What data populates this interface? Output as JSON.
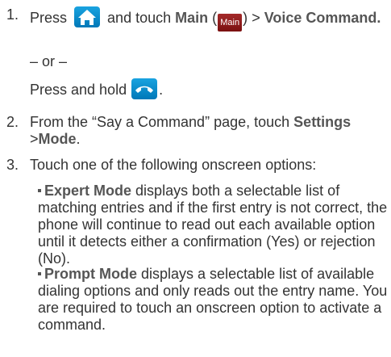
{
  "step1": {
    "num": "1.",
    "press": "Press",
    "and_touch": "and touch",
    "main_label": "Main",
    "paren_open": "(",
    "main_icon_text": "Main",
    "paren_close": ")",
    "gt1": ">",
    "voice_command": "Voice Command.",
    "or": "– or –",
    "press_hold": "Press and hold",
    "period": "."
  },
  "step2": {
    "num": "2.",
    "text": "From the “Say a Command” page, touch",
    "settings": "Settings",
    "gt": ">",
    "mode": "Mode",
    "period": "."
  },
  "step3": {
    "num": "3.",
    "text": "Touch one of the following onscreen options:",
    "expert_title": "Expert Mode",
    "expert_text": "displays both a selectable list of matching entries and if the first entry is not correct, the phone will continue to read out each available option until it detects either a confirmation (Yes) or rejection (No).",
    "prompt_title": "Prompt Mode",
    "prompt_text": "displays a selectable list of available dialing options and only reads out the entry name. You are required to touch an onscreen option to activate a command."
  },
  "icons": {
    "home": "home-icon",
    "main": "main-icon",
    "end_call": "end-call-icon"
  },
  "colors": {
    "text": "#333333",
    "bold": "#555555",
    "icon_blue": "#0a8fd0",
    "icon_red": "#8e1a1a"
  }
}
